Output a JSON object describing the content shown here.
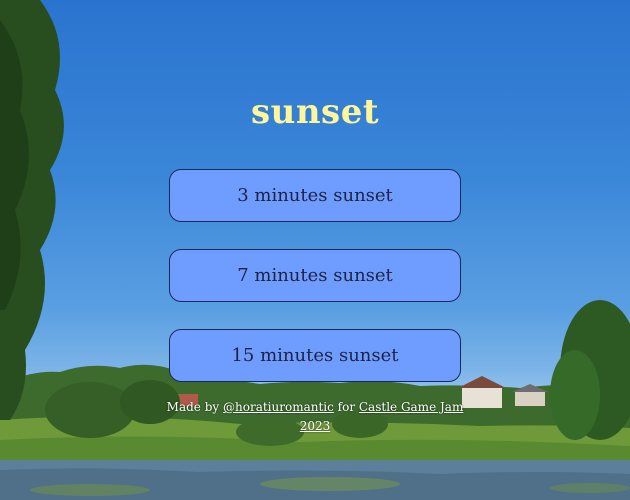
{
  "title": "sunset",
  "buttons": [
    {
      "label": "3 minutes sunset"
    },
    {
      "label": "7 minutes sunset"
    },
    {
      "label": "15 minutes sunset"
    }
  ],
  "credits": {
    "prefix": "Made by ",
    "author_link": "@horatiuromantic",
    "middle": " for ",
    "jam_link": "Castle Game Jam",
    "year": "2023"
  },
  "colors": {
    "title": "#fff59a",
    "button_fill": "#6f9cff",
    "button_border": "#1a2a55",
    "sky": "#2a74cf"
  }
}
